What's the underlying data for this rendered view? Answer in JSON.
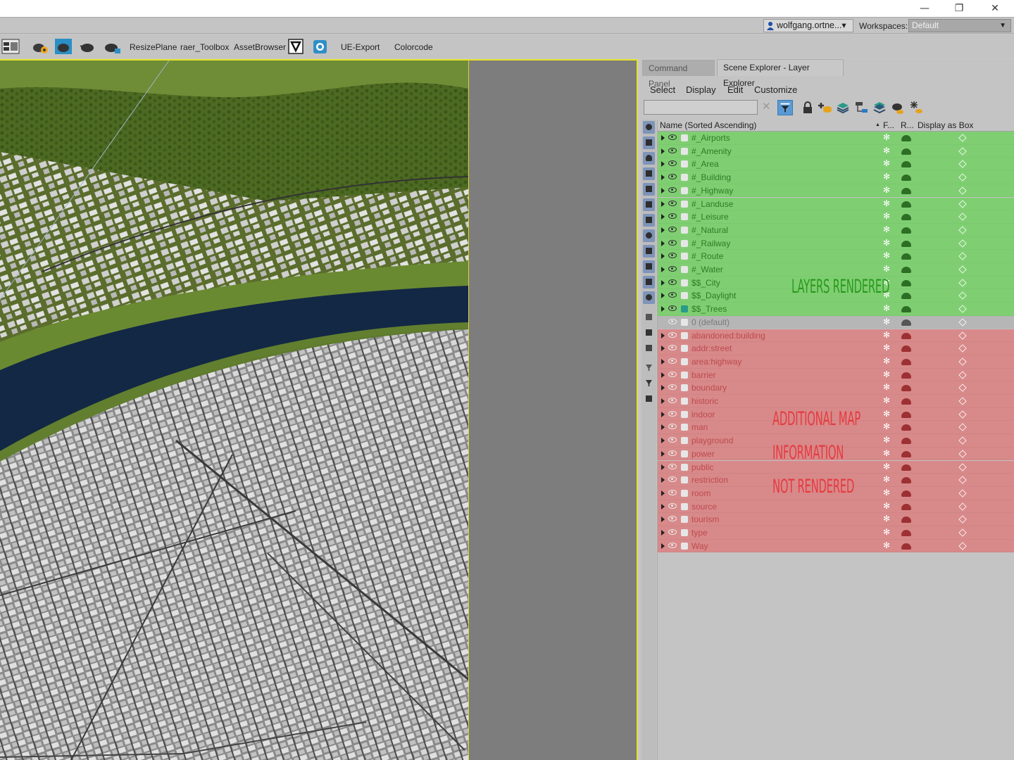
{
  "window": {
    "minimize": "—",
    "restore": "❐",
    "close": "✕"
  },
  "account": {
    "user": "wolfgang.ortne...▾",
    "workspaces_label": "Workspaces:",
    "workspace": "Default"
  },
  "toolbar": {
    "items": [
      "ResizePlane",
      "raer_Toolbox",
      "AssetBrowser",
      "UE-Export",
      "Colorcode"
    ]
  },
  "panel": {
    "tabs": [
      "Command Panel",
      "Scene Explorer - Layer Explorer"
    ],
    "menu": [
      "Select",
      "Display",
      "Edit",
      "Customize"
    ],
    "columns": {
      "name": "Name (Sorted Ascending)",
      "sort_arrow": "▲",
      "freeze": "F...",
      "render": "R...",
      "box": "Display as Box"
    },
    "rows": [
      {
        "name": "#_Airports",
        "group": "green"
      },
      {
        "name": "#_Amenity",
        "group": "green"
      },
      {
        "name": "#_Area",
        "group": "green"
      },
      {
        "name": "#_Building",
        "group": "green"
      },
      {
        "name": "#_Highway",
        "group": "green"
      },
      {
        "name": "#_Landuse",
        "group": "green"
      },
      {
        "name": "#_Leisure",
        "group": "green"
      },
      {
        "name": "#_Natural",
        "group": "green"
      },
      {
        "name": "#_Railway",
        "group": "green"
      },
      {
        "name": "#_Route",
        "group": "green"
      },
      {
        "name": "#_Water",
        "group": "green"
      },
      {
        "name": "$$_City",
        "group": "green"
      },
      {
        "name": "$$_Daylight",
        "group": "green"
      },
      {
        "name": "$$_Trees",
        "group": "green"
      },
      {
        "name": "0 (default)",
        "group": "grey"
      },
      {
        "name": "abandoned:building",
        "group": "red"
      },
      {
        "name": "addr:street",
        "group": "red"
      },
      {
        "name": "area:highway",
        "group": "red"
      },
      {
        "name": "barrier",
        "group": "red"
      },
      {
        "name": "boundary",
        "group": "red"
      },
      {
        "name": "historic",
        "group": "red"
      },
      {
        "name": "indoor",
        "group": "red"
      },
      {
        "name": "man",
        "group": "red"
      },
      {
        "name": "playground",
        "group": "red"
      },
      {
        "name": "power",
        "group": "red"
      },
      {
        "name": "public",
        "group": "red"
      },
      {
        "name": "restriction",
        "group": "red"
      },
      {
        "name": "room",
        "group": "red"
      },
      {
        "name": "source",
        "group": "red"
      },
      {
        "name": "tourism",
        "group": "red"
      },
      {
        "name": "type",
        "group": "red"
      },
      {
        "name": "Way",
        "group": "red"
      }
    ],
    "annotations": {
      "rendered": "LAYERS RENDERED",
      "not_rendered": [
        "ADDITIONAL MAP",
        "INFORMATION",
        "NOT RENDERED"
      ]
    }
  },
  "colors": {
    "rendered_row": "#7fcf72",
    "not_rendered_row": "#d8898a",
    "default_row": "#b6b6b6",
    "viewport_border": "#e5e22a"
  }
}
